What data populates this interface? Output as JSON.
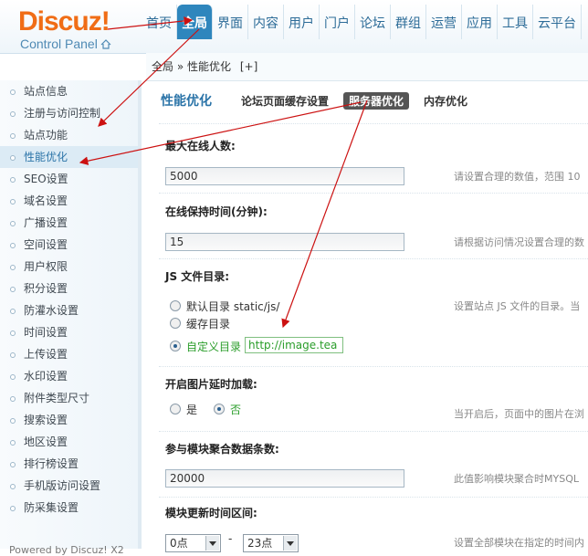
{
  "logo": {
    "word": "Discuz!",
    "subtitle": "Control Panel"
  },
  "topnav": [
    {
      "label": "首页"
    },
    {
      "label": "全局",
      "active": true
    },
    {
      "label": "界面"
    },
    {
      "label": "内容"
    },
    {
      "label": "用户"
    },
    {
      "label": "门户"
    },
    {
      "label": "论坛"
    },
    {
      "label": "群组"
    },
    {
      "label": "运营"
    },
    {
      "label": "应用"
    },
    {
      "label": "工具"
    },
    {
      "label": "云平台"
    }
  ],
  "breadcrumb": {
    "root": "全局",
    "sep": "»",
    "current": "性能优化",
    "add": "[+]"
  },
  "sidebar": [
    "站点信息",
    "注册与访问控制",
    "站点功能",
    "性能优化",
    "SEO设置",
    "域名设置",
    "广播设置",
    "空间设置",
    "用户权限",
    "积分设置",
    "防灌水设置",
    "时间设置",
    "上传设置",
    "水印设置",
    "附件类型尺寸",
    "搜索设置",
    "地区设置",
    "排行榜设置",
    "手机版访问设置",
    "防采集设置"
  ],
  "sidebar_active_index": 3,
  "sidebar_bottom": "Powered by Discuz! X2",
  "subnav": {
    "title": "性能优化",
    "tabs": [
      "论坛页面缓存设置",
      "服务器优化",
      "内存优化"
    ],
    "active": 1
  },
  "fields": {
    "max_online": {
      "label": "最大在线人数:",
      "value": "5000",
      "hint": "请设置合理的数值，范围 10"
    },
    "online_hold": {
      "label": "在线保持时间(分钟):",
      "value": "15",
      "hint": "请根据访问情况设置合理的数"
    },
    "js_dir": {
      "label": "JS 文件目录:",
      "options": [
        "默认目录 static/js/",
        "缓存目录",
        "自定义目录"
      ],
      "selected": 2,
      "custom_value": "http://image.tea",
      "hint": "设置站点 JS 文件的目录。当"
    },
    "lazy_load": {
      "label": "开启图片延时加载:",
      "options": [
        "是",
        "否"
      ],
      "selected": 1,
      "hint": "当开启后，页面中的图片在浏"
    },
    "block_cache": {
      "label": "参与模块聚合数据条数:",
      "value": "20000",
      "hint": "此值影响模块聚合时MYSQL"
    },
    "block_update": {
      "label": "模块更新时间区间:",
      "from": "0点",
      "dash": "-",
      "to": "23点",
      "hint": "设置全部模块在指定的时间内"
    }
  },
  "colors": {
    "accent": "#2e86bd",
    "logo": "#f06d16",
    "annotation_arrow": "#cc1111"
  }
}
